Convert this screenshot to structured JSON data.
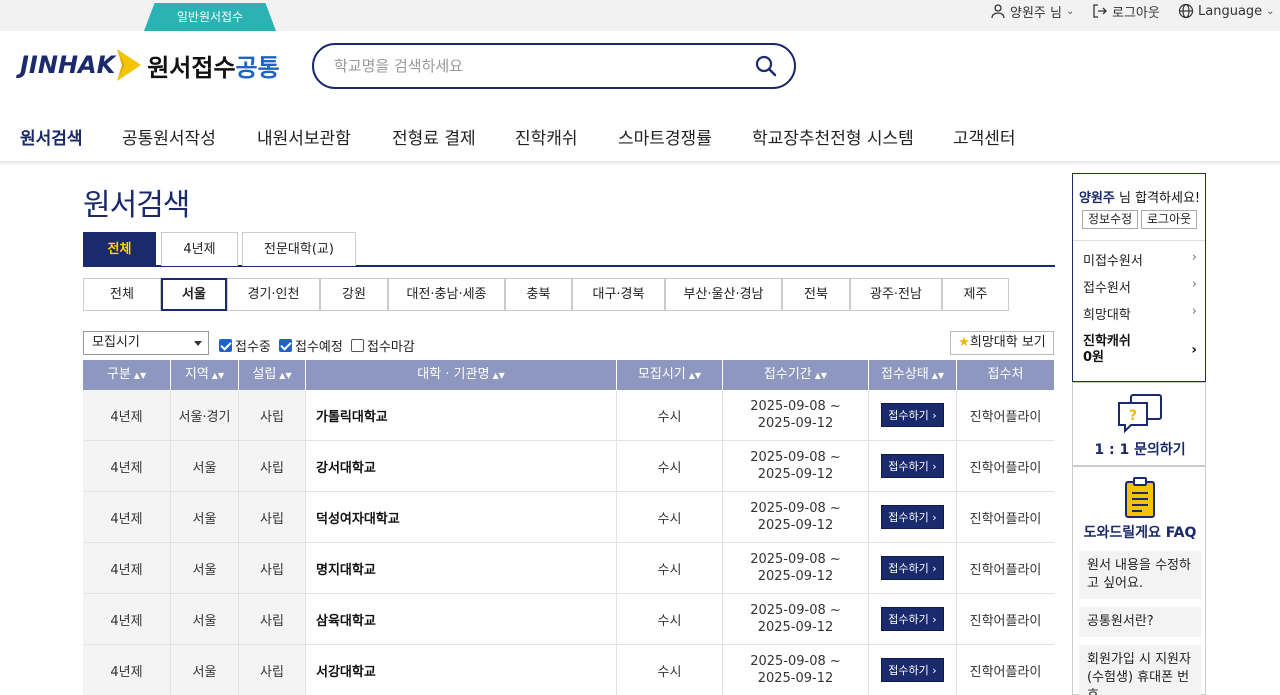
{
  "topbar": {
    "general_tab": "일반원서접수",
    "user": "양원주 님",
    "logout": "로그아웃",
    "language": "Language"
  },
  "header": {
    "logo_text": "JINHAK",
    "title_a": "원서접수",
    "title_b": "공통",
    "search_placeholder": "학교명을 검색하세요"
  },
  "nav": {
    "items": [
      "원서검색",
      "공통원서작성",
      "내원서보관함",
      "전형료 결제",
      "진학캐쉬",
      "스마트경쟁률",
      "학교장추천전형 시스템",
      "고객센터"
    ]
  },
  "page": {
    "title": "원서검색"
  },
  "type_tabs": [
    "전체",
    "4년제",
    "전문대학(교)"
  ],
  "region_tabs": [
    "전체",
    "서울",
    "경기·인천",
    "강원",
    "대전·충남·세종",
    "충북",
    "대구·경북",
    "부산·울산·경남",
    "전북",
    "광주·전남",
    "제주"
  ],
  "filters": {
    "select_value": "모집시기",
    "checks": [
      {
        "label": "접수중",
        "checked": true
      },
      {
        "label": "접수예정",
        "checked": true
      },
      {
        "label": "접수마감",
        "checked": false
      }
    ],
    "fav_button": "희망대학 보기"
  },
  "table": {
    "headers": [
      "구분",
      "지역",
      "설립",
      "대학 · 기관명",
      "모집시기",
      "접수기간",
      "접수상태",
      "접수처"
    ],
    "apply_label": "접수하기",
    "rows": [
      {
        "type": "4년제",
        "region": "서울·경기",
        "found": "사립",
        "name": "가톨릭대학교",
        "season": "수시",
        "start": "2025-09-08 ~",
        "end": "2025-09-12",
        "agent": "진학어플라이"
      },
      {
        "type": "4년제",
        "region": "서울",
        "found": "사립",
        "name": "강서대학교",
        "season": "수시",
        "start": "2025-09-08 ~",
        "end": "2025-09-12",
        "agent": "진학어플라이"
      },
      {
        "type": "4년제",
        "region": "서울",
        "found": "사립",
        "name": "덕성여자대학교",
        "season": "수시",
        "start": "2025-09-08 ~",
        "end": "2025-09-12",
        "agent": "진학어플라이"
      },
      {
        "type": "4년제",
        "region": "서울",
        "found": "사립",
        "name": "명지대학교",
        "season": "수시",
        "start": "2025-09-08 ~",
        "end": "2025-09-12",
        "agent": "진학어플라이"
      },
      {
        "type": "4년제",
        "region": "서울",
        "found": "사립",
        "name": "삼육대학교",
        "season": "수시",
        "start": "2025-09-08 ~",
        "end": "2025-09-12",
        "agent": "진학어플라이"
      },
      {
        "type": "4년제",
        "region": "서울",
        "found": "사립",
        "name": "서강대학교",
        "season": "수시",
        "start": "2025-09-08 ~",
        "end": "2025-09-12",
        "agent": "진학어플라이"
      }
    ]
  },
  "sidebar": {
    "greet_name": "양원주",
    "greet_rest": " 님 합격하세요!",
    "edit_info": "정보수정",
    "logout": "로그아웃",
    "links": [
      "미접수원서",
      "접수원서",
      "희망대학"
    ],
    "cash_label": "진학캐쉬",
    "cash_value": "0원",
    "qa_label": "1 : 1 문의하기",
    "faq_label": "도와드릴게요 FAQ",
    "faq_items": [
      "원서 내용을 수정하고 싶어요.",
      "공통원서란?",
      "회원가입 시 지원자(수험생) 휴대폰 번호"
    ]
  }
}
